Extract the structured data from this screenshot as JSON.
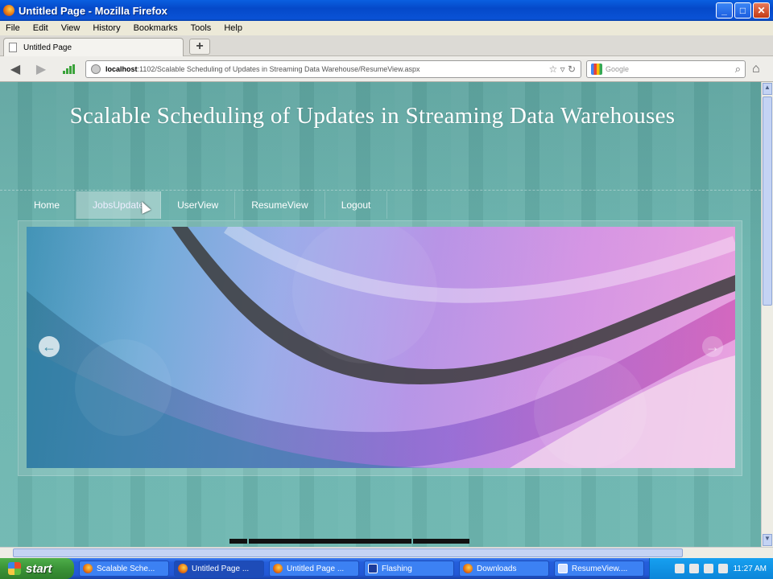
{
  "window": {
    "title": "Untitled Page - Mozilla Firefox",
    "minimize": "_",
    "maximize": "□",
    "close": "✕"
  },
  "menu": [
    "File",
    "Edit",
    "View",
    "History",
    "Bookmarks",
    "Tools",
    "Help"
  ],
  "tab": {
    "label": "Untitled Page",
    "new_tab": "+"
  },
  "nav": {
    "back_icon": "arrow-left-icon",
    "forward_icon": "arrow-right-icon",
    "url_host": "localhost",
    "url_rest": ":1102/Scalable Scheduling of Updates in Streaming Data Warehouse/ResumeView.aspx",
    "search_placeholder": "Google"
  },
  "page": {
    "title": "Scalable Scheduling of Updates in Streaming Data Warehouses",
    "nav_items": [
      "Home",
      "JobsUpdate",
      "UserView",
      "ResumeView",
      "Logout"
    ],
    "active_nav": "JobsUpdate"
  },
  "taskbar": {
    "start": "start",
    "tasks": [
      "Scalable Sche...",
      "Untitled Page ...",
      "Untitled Page ...",
      "Flashing",
      "Downloads",
      "ResumeView...."
    ],
    "clock": "11:27 AM"
  },
  "colors": {
    "page_bg": "#69b3ad",
    "xp_blue": "#245edb",
    "start_green": "#3a9337"
  }
}
